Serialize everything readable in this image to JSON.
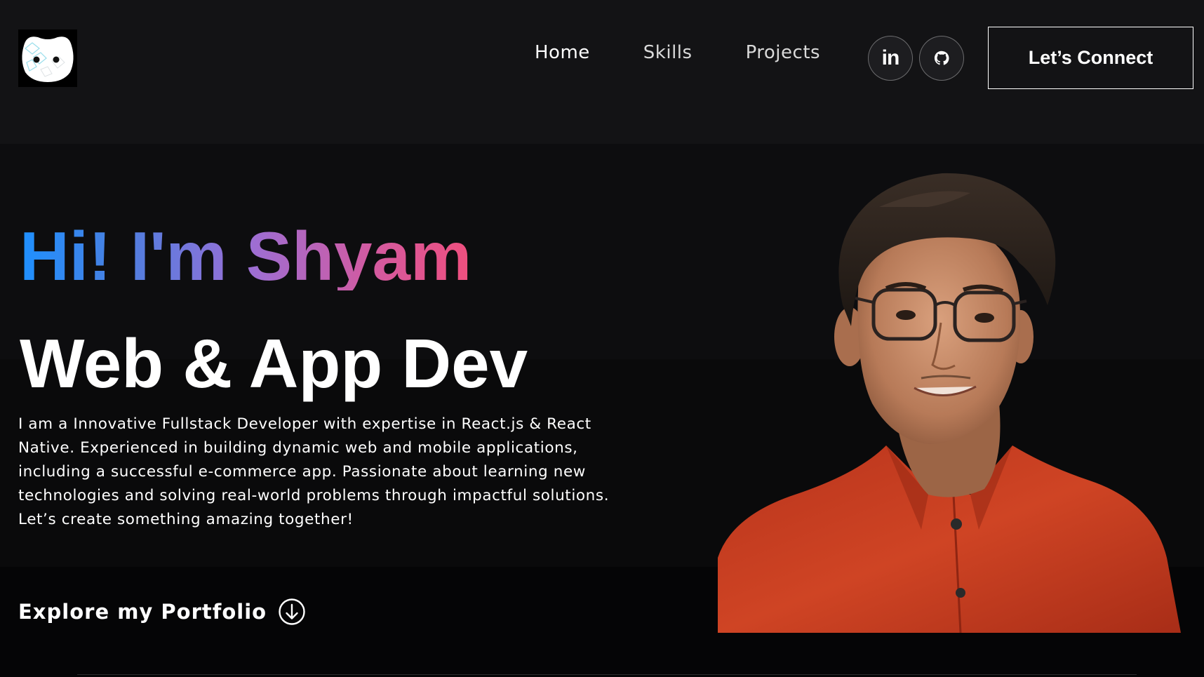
{
  "nav": {
    "links": [
      {
        "label": "Home",
        "active": true
      },
      {
        "label": "Skills",
        "active": false
      },
      {
        "label": "Projects",
        "active": false
      }
    ],
    "social": [
      {
        "name": "linkedin",
        "icon": "linkedin-icon",
        "glyph": "in"
      },
      {
        "name": "github",
        "icon": "github-icon"
      }
    ],
    "cta_label": "Let’s Connect"
  },
  "hero": {
    "greeting": "Hi! I'm Shyam",
    "role": "Web & App Dev",
    "bio": "I am a Innovative Fullstack Developer with expertise in React.js & React Native. Experienced in building dynamic web and mobile applications, including a successful e-commerce app. Passionate about learning new technologies and solving real-world problems through impactful solutions. Let’s create something amazing together!",
    "explore_label": "Explore my Portfolio",
    "explore_icon": "arrow-down-circle-icon"
  },
  "colors": {
    "background": "#131315",
    "accent_gradient": [
      "#1e90ff",
      "#9a6fd6",
      "#ef4f7e"
    ],
    "shirt": "#c0391f"
  }
}
